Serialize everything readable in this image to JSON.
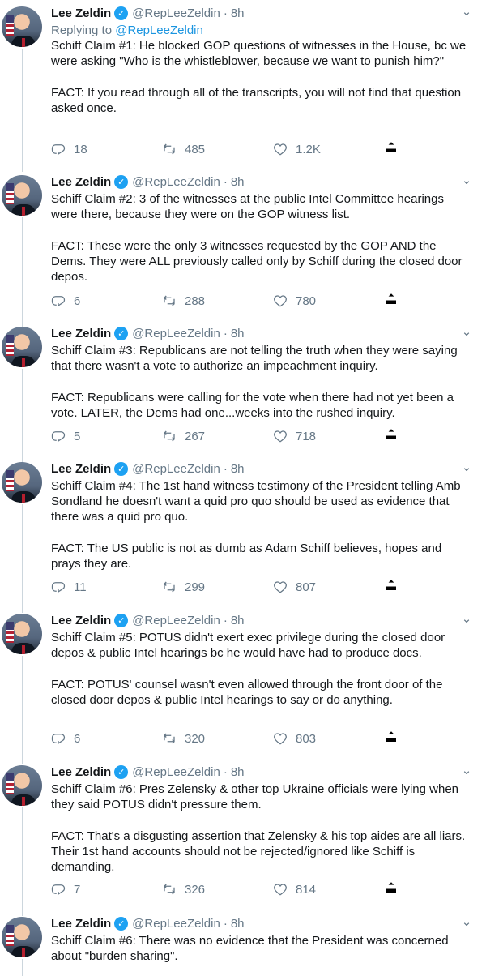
{
  "tweets": [
    {
      "author": "Lee Zeldin",
      "handle": "@RepLeeZeldin",
      "time": "8h",
      "reply_prefix": "Replying to ",
      "reply_to": "@RepLeeZeldin",
      "text": "Schiff Claim #1: He blocked GOP questions of witnesses in the House, bc we were asking \"Who is the whistleblower, because we want to punish him?\"\n\nFACT: If you read through all of the transcripts, you will not find that question asked once.",
      "replies": "18",
      "retweets": "485",
      "likes": "1.2K"
    },
    {
      "author": "Lee Zeldin",
      "handle": "@RepLeeZeldin",
      "time": "8h",
      "text": "Schiff Claim #2: 3 of the witnesses at the public Intel Committee hearings were there, because they were on the GOP witness list.\n\nFACT: These were the only 3 witnesses requested by the GOP AND the Dems. They were ALL previously called only by Schiff during the closed door depos.",
      "replies": "6",
      "retweets": "288",
      "likes": "780"
    },
    {
      "author": "Lee Zeldin",
      "handle": "@RepLeeZeldin",
      "time": "8h",
      "text": "Schiff Claim #3: Republicans are not telling the truth when they were saying that there wasn't a vote to authorize an impeachment inquiry.\n\nFACT: Republicans were calling for the vote when there had not yet been a vote. LATER, the Dems had one...weeks into the rushed inquiry.",
      "replies": "5",
      "retweets": "267",
      "likes": "718"
    },
    {
      "author": "Lee Zeldin",
      "handle": "@RepLeeZeldin",
      "time": "8h",
      "text": "Schiff Claim #4: The 1st hand witness testimony of the President telling Amb Sondland he doesn't want a quid pro quo should be used as evidence that there was a quid pro quo.\n\nFACT: The US public is not as dumb as Adam Schiff believes, hopes and prays they are.",
      "replies": "11",
      "retweets": "299",
      "likes": "807"
    },
    {
      "author": "Lee Zeldin",
      "handle": "@RepLeeZeldin",
      "time": "8h",
      "text": "Schiff Claim #5: POTUS didn't exert exec privilege during the closed door depos & public Intel hearings bc he would have had to produce docs.\n\nFACT: POTUS' counsel wasn't even allowed through the front door of the closed door depos & public Intel hearings to say or do anything.",
      "replies": "6",
      "retweets": "320",
      "likes": "803"
    },
    {
      "author": "Lee Zeldin",
      "handle": "@RepLeeZeldin",
      "time": "8h",
      "text": "Schiff Claim #6: Pres Zelensky & other top Ukraine officials were lying when they said POTUS didn't pressure them.\n\nFACT: That's a disgusting assertion that Zelensky & his top aides are all liars. Their 1st hand accounts should not be rejected/ignored like Schiff is demanding.",
      "replies": "7",
      "retweets": "326",
      "likes": "814"
    },
    {
      "author": "Lee Zeldin",
      "handle": "@RepLeeZeldin",
      "time": "8h",
      "text": "Schiff Claim #6: There was no evidence that the President was concerned about \"burden sharing\"."
    }
  ],
  "ui": {
    "time_separator": "·",
    "verified_mark": "✓",
    "menu_chevron": "⌄",
    "icons": [
      "reply-icon",
      "retweet-icon",
      "like-icon",
      "share-icon",
      "verified-badge-icon",
      "chevron-down-icon"
    ],
    "colors": {
      "text": "#14171a",
      "secondary": "#657786",
      "link": "#1b95e0",
      "verified": "#1da1f2",
      "thread_line": "#ccd6dd"
    }
  }
}
